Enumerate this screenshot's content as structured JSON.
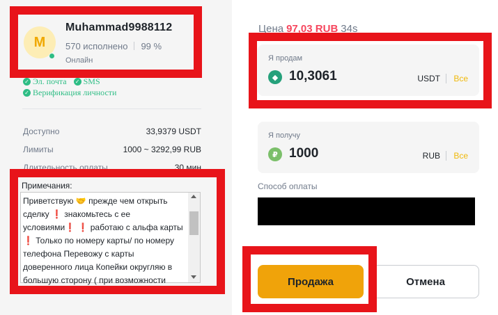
{
  "merchant": {
    "avatar_letter": "M",
    "name": "Muhammad9988112",
    "orders_completed": "570 исполнено",
    "completion_rate": "99 %",
    "status": "Онлайн",
    "verifications": [
      "Эл. почта",
      "SMS",
      "Верификация личности"
    ]
  },
  "details": {
    "available_label": "Доступно",
    "available_value": "33,9379 USDT",
    "limits_label": "Лимиты",
    "limits_value": "1000 ~ 3292,99 RUB",
    "payment_time_label": "Длительность оплаты",
    "payment_time_value": "30 мин"
  },
  "notes": {
    "label": "Примечания:",
    "text": "Приветствую 🤝 прежде чем открыть сделку ❗ знакомьтесь с ее условиями❗ ❗ работаю с альфа карты ❗ Только по номеру карты/ по номеру телефона Перевожу с карты доверенного лица Копейки округляю в большую сторону ( при возможности"
  },
  "order": {
    "price_label": "Цена",
    "price_value": "97,03 RUB",
    "timer": "34s",
    "sell_label": "Я продам",
    "sell_amount": "10,3061",
    "sell_unit": "USDT",
    "receive_label": "Я получу",
    "receive_amount": "1000",
    "receive_unit": "RUB",
    "all_label": "Все",
    "payment_method_label": "Способ оплаты"
  },
  "buttons": {
    "sell": "Продажа",
    "cancel": "Отмена"
  },
  "colors": {
    "highlight": "#e8141a",
    "accent": "#f0a30a",
    "price_red": "#f6465d",
    "verified_green": "#2ebd85"
  }
}
